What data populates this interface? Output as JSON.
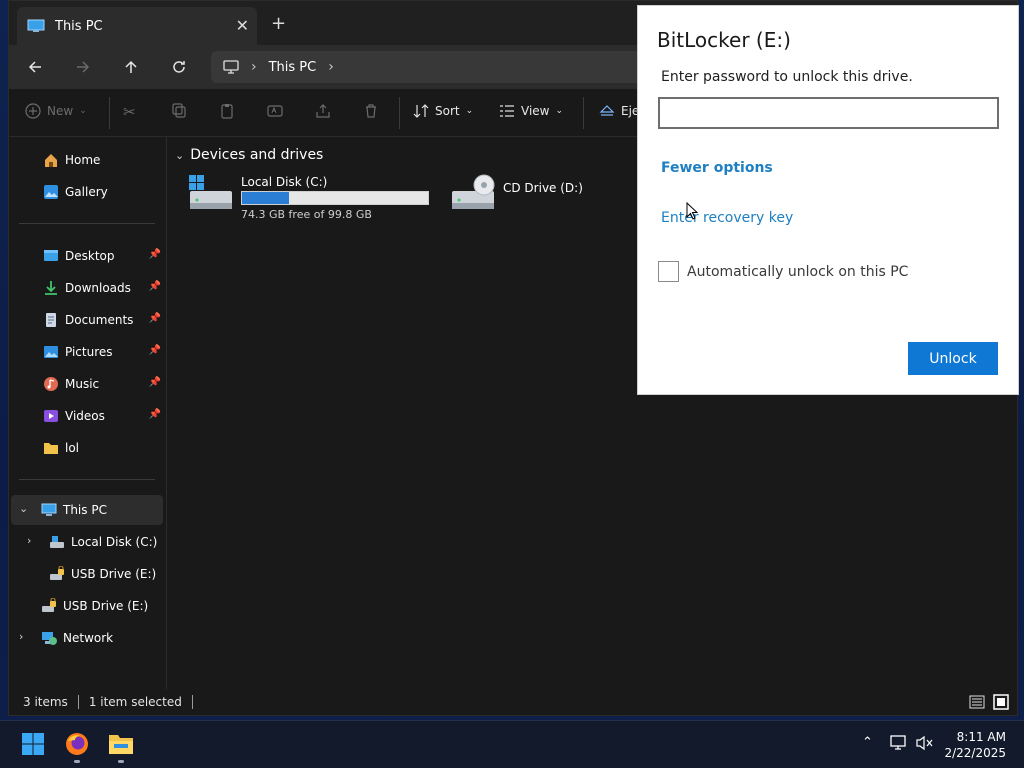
{
  "window": {
    "tab_title": "This PC",
    "tab_close": "✕",
    "new_tab": "+",
    "address_path": "This PC"
  },
  "toolbar": {
    "new_label": "New",
    "sort_label": "Sort",
    "view_label": "View",
    "eject_label": "Eje"
  },
  "sidebar": {
    "items": [
      {
        "label": "Home"
      },
      {
        "label": "Gallery"
      },
      {
        "label": "Desktop"
      },
      {
        "label": "Downloads"
      },
      {
        "label": "Documents"
      },
      {
        "label": "Pictures"
      },
      {
        "label": "Music"
      },
      {
        "label": "Videos"
      },
      {
        "label": "lol"
      },
      {
        "label": "This PC"
      },
      {
        "label": "Local Disk (C:)"
      },
      {
        "label": "USB Drive (E:)"
      },
      {
        "label": "USB Drive (E:)"
      },
      {
        "label": "Network"
      }
    ]
  },
  "content": {
    "group_header": "Devices and drives",
    "drives": [
      {
        "label": "Local Disk (C:)",
        "subtitle": "74.3 GB free of 99.8 GB",
        "used_fraction": 0.255
      },
      {
        "label": "CD Drive (D:)"
      }
    ]
  },
  "status": {
    "items_count": "3 items",
    "selected": "1 item selected"
  },
  "dialog": {
    "title": "BitLocker (E:)",
    "prompt": "Enter password to unlock this drive.",
    "password_value": "",
    "fewer_options": "Fewer options",
    "recovery_link": "Enter recovery key",
    "auto_unlock_label": "Automatically unlock on this PC",
    "auto_unlock_checked": false,
    "unlock_button": "Unlock"
  },
  "taskbar": {
    "time": "8:11 AM",
    "date": "2/22/2025"
  },
  "colors": {
    "accent": "#0f78d4",
    "link": "#1e7fc2",
    "drive_bar": "#2a7fd4"
  }
}
